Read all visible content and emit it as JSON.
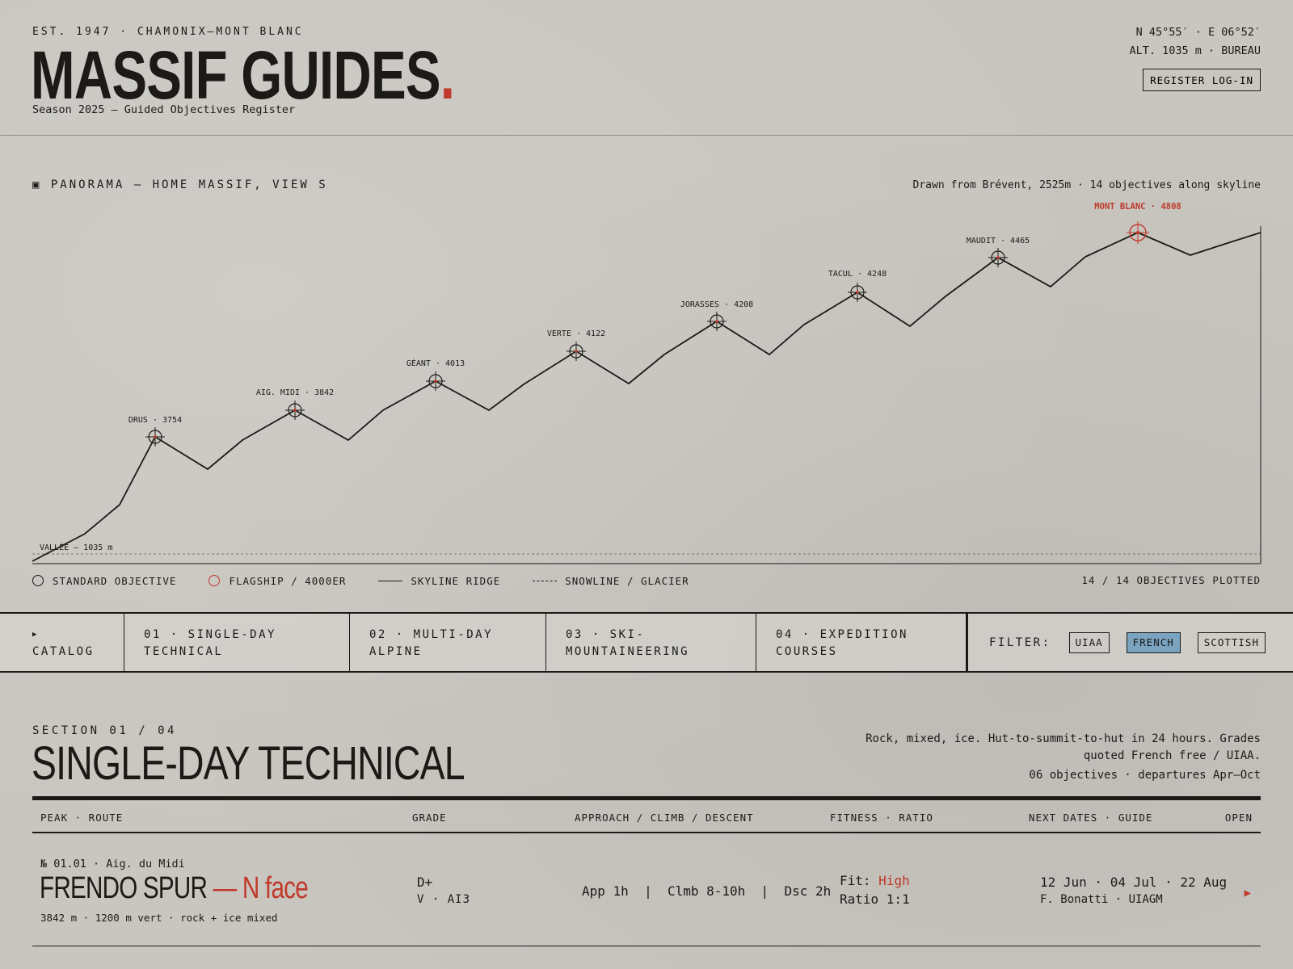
{
  "header": {
    "est_line": "EST. 1947 · CHAMONIX–MONT BLANC",
    "brand_name": "MASSIF GUIDES",
    "brand_dot": ".",
    "season": "Season 2025 — Guided Objectives Register",
    "coords": "N 45°55′ · E 06°52′",
    "altitude": "ALT. 1035 m · BUREAU",
    "register_button": "REGISTER LOG-IN"
  },
  "panorama": {
    "title": "▣ PANORAMA — HOME MASSIF, VIEW S",
    "caption": "Drawn from Brévent, 2525m · 14 objectives along skyline",
    "valley_label": "VALLÉE — 1035 m",
    "peaks": [
      {
        "label": "DRUS · 3754",
        "flagship": false
      },
      {
        "label": "AIG. MIDI · 3842",
        "flagship": false
      },
      {
        "label": "GÉANT · 4013",
        "flagship": false
      },
      {
        "label": "VERTE · 4122",
        "flagship": false
      },
      {
        "label": "JORASSES · 4208",
        "flagship": false
      },
      {
        "label": "TACUL · 4248",
        "flagship": false
      },
      {
        "label": "MAUDIT · 4465",
        "flagship": false
      },
      {
        "label": "MONT BLANC · 4808",
        "flagship": true
      }
    ],
    "legend": {
      "standard": "STANDARD OBJECTIVE",
      "flagship": "FLAGSHIP / 4000ER",
      "skyline": "SKYLINE RIDGE",
      "snowline": "SNOWLINE / GLACIER"
    },
    "plotted": "14 / 14 OBJECTIVES PLOTTED",
    "colors": {
      "ink": "#1b1a17",
      "flagship": "#c0392b"
    }
  },
  "tabs": {
    "catalog_arrow": "▶",
    "catalog": "CATALOG",
    "items": [
      {
        "line1": "01 · SINGLE-DAY",
        "line2": "TECHNICAL"
      },
      {
        "line1": "02 · MULTI-DAY",
        "line2": "ALPINE"
      },
      {
        "line1": "03 · SKI-",
        "line2": "MOUNTAINEERING"
      },
      {
        "line1": "04 · EXPEDITION",
        "line2": "COURSES"
      }
    ],
    "filter_label": "FILTER:",
    "filters": [
      "UIAA",
      "FRENCH",
      "SCOTTISH"
    ],
    "active_filter": "FRENCH",
    "active_color": "#7aa3c0"
  },
  "section": {
    "kicker": "SECTION 01 / 04",
    "title": "SINGLE-DAY TECHNICAL",
    "description": "Rock, mixed, ice. Hut-to-summit-to-hut in 24 hours. Grades quoted French free / UIAA.",
    "count": "06 objectives · departures Apr–Oct"
  },
  "table": {
    "headers": {
      "peak_route": "PEAK · ROUTE",
      "grade": "GRADE",
      "times": "APPROACH / CLIMB / DESCENT",
      "fitness": "FITNESS · RATIO",
      "dates": "NEXT DATES · GUIDE",
      "open": "OPEN"
    },
    "rows": [
      {
        "ref": "№ 01.01 · Aig. du Midi",
        "route": "FRENDO SPUR",
        "variant": " — N face",
        "sub": "3842 m · 1200 m vert · rock + ice mixed",
        "grade_french": "D+",
        "grade_uiaa": "V · AI3",
        "times": "App 1h  |  Clmb 8-10h  |  Dsc 2h",
        "fitness_label": "Fit: ",
        "fitness_value": "High",
        "ratio": "Ratio 1:1",
        "dates": "12 Jun · 04 Jul · 22 Aug",
        "guide": "F. Bonatti · UIAGM",
        "open_icon": "▶"
      }
    ]
  }
}
